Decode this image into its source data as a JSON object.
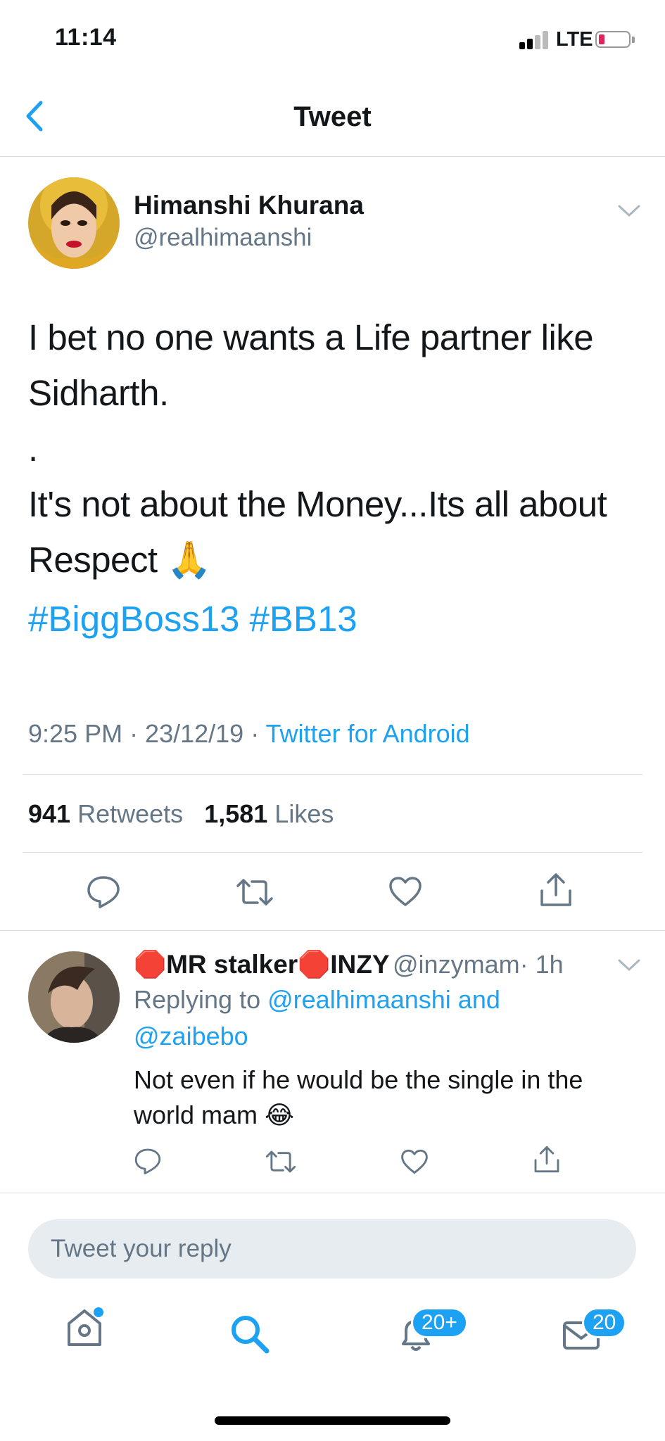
{
  "status_bar": {
    "time": "11:14",
    "network": "LTE"
  },
  "header": {
    "title": "Tweet"
  },
  "tweet": {
    "author_name": "Himanshi Khurana",
    "author_handle": "@realhimaanshi",
    "text_lines": [
      "I bet no one wants a Life partner like",
      "Sidharth.",
      ".",
      "It's not about the Money...Its all about",
      "Respect 🙏"
    ],
    "hashtags": [
      "#BiggBoss13",
      "#BB13"
    ],
    "time": "9:25 PM · 23/12/19 · ",
    "source": "Twitter for Android",
    "retweet_count": "941",
    "retweets_label": "Retweets",
    "like_count": "1,581",
    "likes_label": "Likes"
  },
  "reply": {
    "name": "🛑MR stalker🛑INZY",
    "handle": "@inzymam",
    "time": "· 1h",
    "replying_label": "Replying to",
    "replying_line1": "@realhimaanshi and",
    "replying_line2": "@zaibebo",
    "text_line1": "Not even if he would be the single in the",
    "text_line2": "world mam 😂"
  },
  "composer": {
    "placeholder": "Tweet your reply"
  },
  "tab_bar": {
    "notifications_badge": "20+",
    "messages_badge": "20"
  },
  "colors": {
    "accent": "#1da1f2",
    "secondary_text": "#657786",
    "divider": "#d8dde1"
  },
  "icons": [
    "back-chevron-icon",
    "chevron-down-icon",
    "reply-icon",
    "retweet-icon",
    "like-icon",
    "share-icon",
    "home-icon",
    "search-icon",
    "notifications-icon",
    "messages-icon"
  ]
}
